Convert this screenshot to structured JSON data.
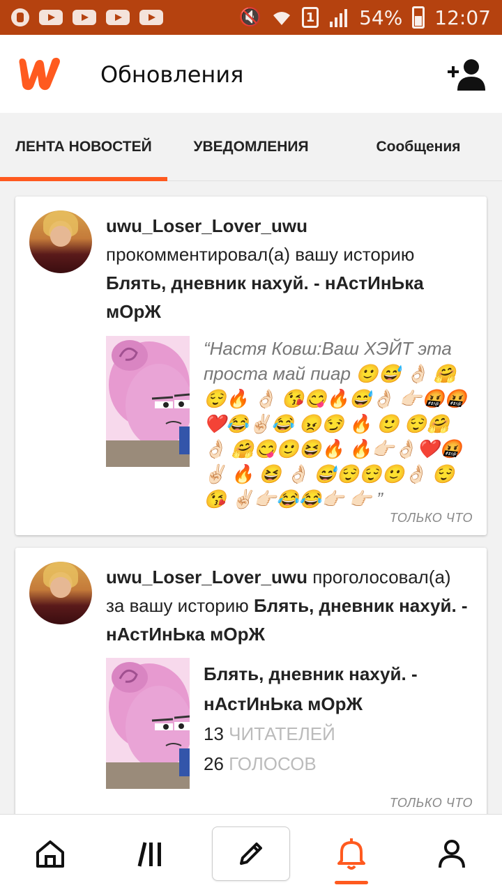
{
  "status_bar": {
    "battery_percent": "54%",
    "time": "12:07",
    "sim_slot": "1"
  },
  "header": {
    "title": "Обновления",
    "logo_icon": "wattpad-logo-icon",
    "action_icon": "add-friend-icon"
  },
  "tabs": [
    {
      "label": "ЛЕНТА НОВОСТЕЙ",
      "active": true
    },
    {
      "label": "УВЕДОМЛЕНИЯ",
      "active": false
    },
    {
      "label": "Сообщения",
      "active": false
    }
  ],
  "feed": [
    {
      "username": "uwu_Loser_Lover_uwu",
      "action": " прокомментировал(а) вашу историю ",
      "story_title": "Блять, дневник нахуй. - нАстИнЬка мОрЖ",
      "quote": "“Настя Ковш:Ваш ХЭЙТ эта проста май пиар 🙂😅 👌🏻 🤗 😌🔥 👌🏻 😘😋🔥😅👌🏻 👉🏻🤬🤬 ❤️😂✌🏻😂 😠😏 🔥 🙂 😌🤗 👌🏻 🤗😋🙂😆🔥 🔥👉🏻👌🏻❤️🤬 ✌🏻 🔥 😆 👌🏻 😅😌😌🙂👌🏻 😌 😘 ✌🏻👉🏻😂😂👉🏻 👉🏻 ”",
      "timestamp": "ТОЛЬКО ЧТО"
    },
    {
      "username": "uwu_Loser_Lover_uwu",
      "action": " проголосовал(а) за вашу историю ",
      "story_title": "Блять, дневник нахуй. - нАстИнЬка мОрЖ",
      "card_title": "Блять, дневник нахуй. - нАстИнЬка мОрЖ",
      "readers_count": "13",
      "readers_label": "ЧИТАТЕЛЕЙ",
      "votes_count": "26",
      "votes_label": "ГОЛОСОВ",
      "timestamp": "ТОЛЬКО ЧТО"
    }
  ],
  "bottom_nav": [
    {
      "name": "home",
      "icon": "home-icon",
      "active": false
    },
    {
      "name": "library",
      "icon": "library-icon",
      "active": false
    },
    {
      "name": "write",
      "icon": "pencil-icon",
      "active": false
    },
    {
      "name": "notifications",
      "icon": "bell-icon",
      "active": true
    },
    {
      "name": "profile",
      "icon": "profile-icon",
      "active": false
    }
  ],
  "colors": {
    "accent": "#ff5a1f",
    "status_bar": "#b5420f"
  }
}
